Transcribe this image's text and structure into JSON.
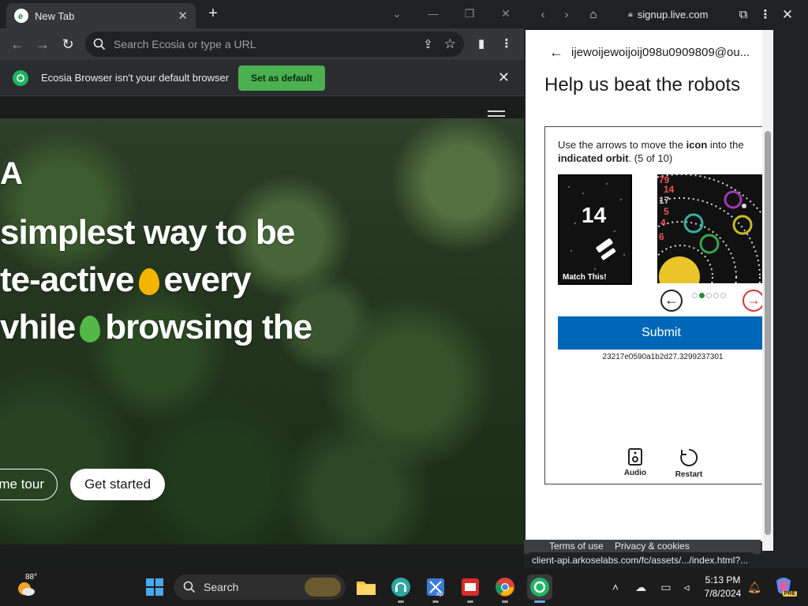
{
  "browser": {
    "tab_title": "New Tab",
    "omnibox_placeholder": "Search Ecosia or type a URL",
    "infobar_message": "Ecosia Browser isn't your default browser",
    "infobar_button": "Set as default"
  },
  "hero": {
    "partial_logo": "A",
    "line1": "simplest way to be",
    "line2a": "te-active",
    "line2b": "every",
    "line3a": "vhile",
    "line3b": "browsing the",
    "tour_button": "me tour",
    "start_button": "Get started"
  },
  "signin": {
    "url": "signup.live.com",
    "email": "ijewoijewoijoij098u0909809@ou...",
    "heading": "Help us beat the robots",
    "instruction_pre": "Use the arrows to move the ",
    "instruction_bold1": "icon",
    "instruction_mid": " into the ",
    "instruction_bold2": "indicated orbit",
    "instruction_post": ". (5 of 10)",
    "match_number": "14",
    "match_label": "Match This!",
    "orbit_numbers": [
      "79",
      "14",
      "17",
      "5",
      "4",
      "6"
    ],
    "submit_label": "Submit",
    "session_id": "23217e0590a1b2d27.3299237301",
    "audio_label": "Audio",
    "restart_label": "Restart",
    "footer_terms": "Terms of use",
    "footer_privacy": "Privacy & cookies",
    "status_url": "client-api.arkoselabs.com/fc/assets/.../index.html?..."
  },
  "taskbar": {
    "weather_temp": "88°",
    "search_placeholder": "Search",
    "time": "5:13 PM",
    "date": "7/8/2024",
    "copilot_badge": "PRE"
  },
  "colors": {
    "accent_green": "#4caf50",
    "submit_blue": "#0067b8",
    "leaf_orange": "#f4b400",
    "leaf_green": "#54b848"
  }
}
